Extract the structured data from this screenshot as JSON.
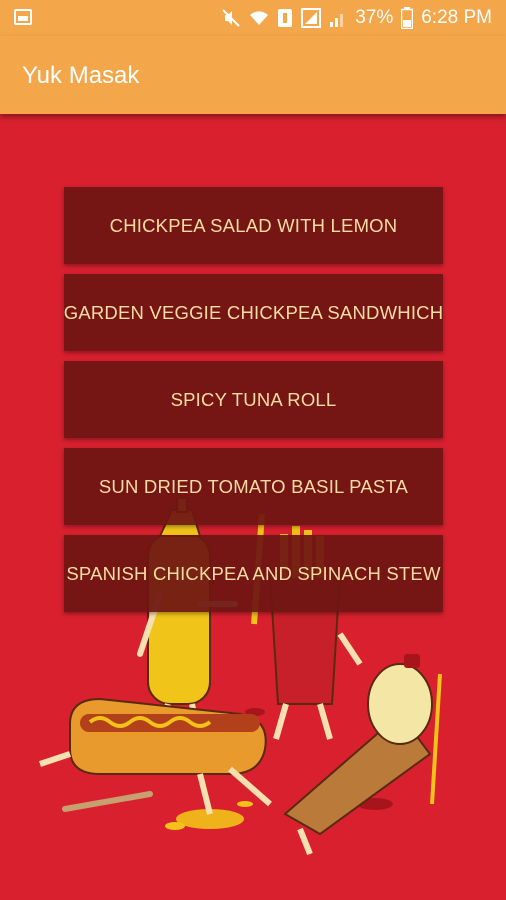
{
  "status_bar": {
    "battery_percent": "37%",
    "time": "6:28 PM",
    "icons": [
      "gallery-icon",
      "mute-icon",
      "wifi-icon",
      "data-saver-icon",
      "signal-icon",
      "signal-icon-2",
      "battery-icon"
    ]
  },
  "app_bar": {
    "title": "Yuk Masak"
  },
  "menu": {
    "items": [
      {
        "label": "CHICKPEA SALAD WITH LEMON"
      },
      {
        "label": "GARDEN VEGGIE CHICKPEA SANDWHICH"
      },
      {
        "label": "SPICY TUNA ROLL"
      },
      {
        "label": "SUN DRIED TOMATO BASIL PASTA"
      },
      {
        "label": "SPANISH CHICKPEA AND SPINACH STEW"
      }
    ]
  },
  "colors": {
    "app_bar": "#f4a64a",
    "background": "#d8202f",
    "button": "#6e1612",
    "button_text": "#f7dca4"
  }
}
